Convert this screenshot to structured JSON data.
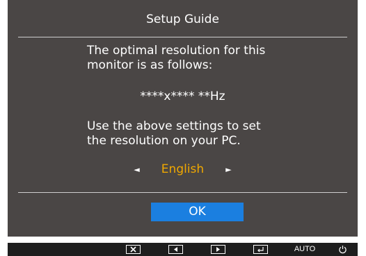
{
  "dialog": {
    "title": "Setup Guide",
    "message_1": "The optimal resolution for this\nmonitor is as follows:",
    "resolution": "****x**** **Hz",
    "message_2": "Use the above settings to set\nthe resolution on your PC.",
    "language": {
      "prev_arrow": "◄",
      "value": "English",
      "next_arrow": "►"
    },
    "ok_label": "OK"
  },
  "keybar": {
    "close_icon": "close-icon",
    "left_icon": "left-arrow-icon",
    "right_icon": "right-arrow-icon",
    "enter_icon": "enter-icon",
    "auto_label": "AUTO",
    "power_icon": "power-icon"
  },
  "colors": {
    "osd_background": "#4a4645",
    "accent_text": "#f0a800",
    "ok_button": "#1b7fe0",
    "keybar_background": "#1e1e1e"
  }
}
